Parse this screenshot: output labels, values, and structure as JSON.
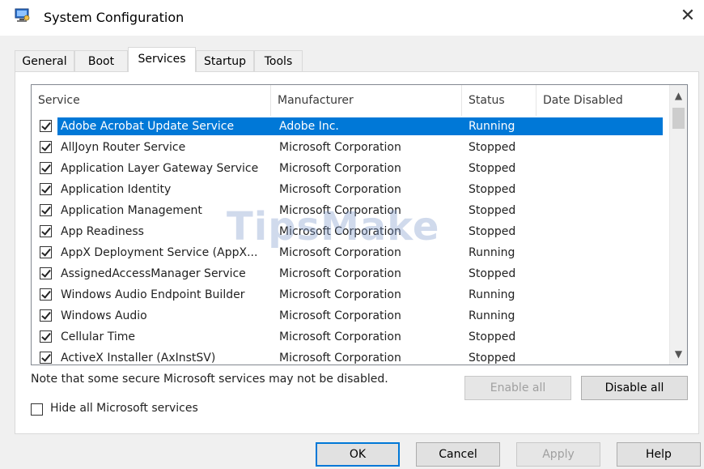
{
  "window": {
    "title": "System Configuration",
    "close_glyph": "✕"
  },
  "tabs": [
    {
      "label": "General",
      "active": false
    },
    {
      "label": "Boot",
      "active": false
    },
    {
      "label": "Services",
      "active": true
    },
    {
      "label": "Startup",
      "active": false
    },
    {
      "label": "Tools",
      "active": false
    }
  ],
  "table": {
    "columns": [
      "Service",
      "Manufacturer",
      "Status",
      "Date Disabled"
    ],
    "rows": [
      {
        "service": "Adobe Acrobat Update Service",
        "manufacturer": "Adobe Inc.",
        "status": "Running",
        "date_disabled": "",
        "checked": true,
        "selected": true
      },
      {
        "service": "AllJoyn Router Service",
        "manufacturer": "Microsoft Corporation",
        "status": "Stopped",
        "date_disabled": "",
        "checked": true,
        "selected": false
      },
      {
        "service": "Application Layer Gateway Service",
        "manufacturer": "Microsoft Corporation",
        "status": "Stopped",
        "date_disabled": "",
        "checked": true,
        "selected": false
      },
      {
        "service": "Application Identity",
        "manufacturer": "Microsoft Corporation",
        "status": "Stopped",
        "date_disabled": "",
        "checked": true,
        "selected": false
      },
      {
        "service": "Application Management",
        "manufacturer": "Microsoft Corporation",
        "status": "Stopped",
        "date_disabled": "",
        "checked": true,
        "selected": false
      },
      {
        "service": "App Readiness",
        "manufacturer": "Microsoft Corporation",
        "status": "Stopped",
        "date_disabled": "",
        "checked": true,
        "selected": false
      },
      {
        "service": "AppX Deployment Service (AppX...",
        "manufacturer": "Microsoft Corporation",
        "status": "Running",
        "date_disabled": "",
        "checked": true,
        "selected": false
      },
      {
        "service": "AssignedAccessManager Service",
        "manufacturer": "Microsoft Corporation",
        "status": "Stopped",
        "date_disabled": "",
        "checked": true,
        "selected": false
      },
      {
        "service": "Windows Audio Endpoint Builder",
        "manufacturer": "Microsoft Corporation",
        "status": "Running",
        "date_disabled": "",
        "checked": true,
        "selected": false
      },
      {
        "service": "Windows Audio",
        "manufacturer": "Microsoft Corporation",
        "status": "Running",
        "date_disabled": "",
        "checked": true,
        "selected": false
      },
      {
        "service": "Cellular Time",
        "manufacturer": "Microsoft Corporation",
        "status": "Stopped",
        "date_disabled": "",
        "checked": true,
        "selected": false
      },
      {
        "service": "ActiveX Installer (AxInstSV)",
        "manufacturer": "Microsoft Corporation",
        "status": "Stopped",
        "date_disabled": "",
        "checked": true,
        "selected": false
      }
    ]
  },
  "note": "Note that some secure Microsoft services may not be disabled.",
  "buttons": {
    "enable_all": "Enable all",
    "disable_all": "Disable all",
    "ok": "OK",
    "cancel": "Cancel",
    "apply": "Apply",
    "help": "Help"
  },
  "hide_ms": {
    "label": "Hide all Microsoft services",
    "checked": false
  },
  "watermark": "TipsMake",
  "colors": {
    "selection": "#0078d7",
    "accent": "#0078d7"
  },
  "icons": {
    "app": "system-config-icon",
    "scroll_up": "chevron-up-icon",
    "scroll_down": "chevron-down-icon"
  }
}
